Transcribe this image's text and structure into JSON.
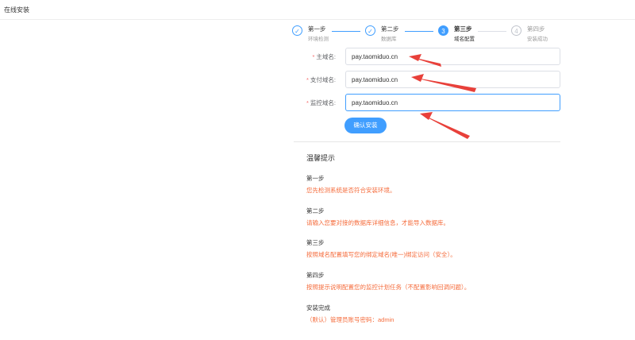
{
  "header": {
    "title": "在线安装"
  },
  "steps": [
    {
      "index": "✓",
      "title": "第一步",
      "desc": "环境检测",
      "status": "done"
    },
    {
      "index": "✓",
      "title": "第二步",
      "desc": "数据库",
      "status": "done"
    },
    {
      "index": "3",
      "title": "第三步",
      "desc": "域名配置",
      "status": "active"
    },
    {
      "index": "4",
      "title": "第四步",
      "desc": "安装成功",
      "status": "wait"
    }
  ],
  "form": {
    "required_mark": "*",
    "fields": [
      {
        "label": "主域名:",
        "value": "pay.taomiduo.cn"
      },
      {
        "label": "支付域名:",
        "value": "pay.taomiduo.cn"
      },
      {
        "label": "监控域名:",
        "value": "pay.taomiduo.cn"
      }
    ],
    "submit_label": "确认安装"
  },
  "tips": {
    "title": "温馨提示",
    "items": [
      {
        "title": "第一步",
        "text": "您先检测系统是否符合安装环境。"
      },
      {
        "title": "第二步",
        "text": "请输入您要对接的数据库详细信息，才能导入数据库。"
      },
      {
        "title": "第三步",
        "text": "按照域名配置填写您的绑定域名(唯一)绑定访问（安全）。"
      },
      {
        "title": "第四步",
        "text": "按照提示说明配置您的监控计划任务（不配置影响回调问题）。"
      },
      {
        "title": "安装完成",
        "text": "（默认）管理员账号密码：admin"
      }
    ]
  },
  "colors": {
    "primary": "#409eff",
    "arrow": "#e8403a",
    "tip_text": "#f56c3c"
  }
}
